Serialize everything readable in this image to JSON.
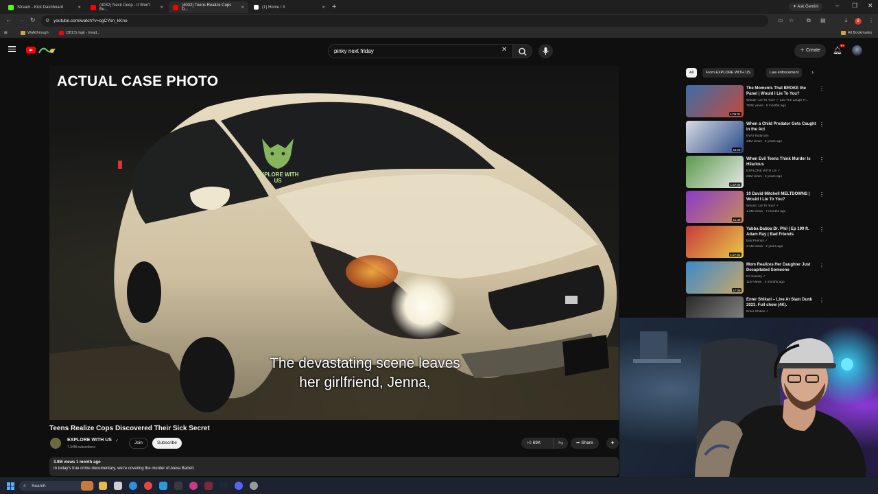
{
  "browser": {
    "tabs": [
      {
        "label": "Stream - Kick Dashboard",
        "color": "#53fc18",
        "active": false
      },
      {
        "label": "(4032) Neck Deep - It Won't Be...",
        "color": "#ff0000",
        "active": false
      },
      {
        "label": "(4032) Teens Realize Cops D...",
        "color": "#ff0000",
        "active": true
      },
      {
        "label": "(1) Home / X",
        "color": "#ffffff",
        "active": false
      }
    ],
    "new_tab": "+",
    "ask_gemini": "Ask Gemini",
    "url": "youtube.com/watch?v=cgCYon_kKno",
    "profile_badge": "8",
    "bookmarks": [
      {
        "label": "Walkthrough"
      },
      {
        "label": "(3813) mgk - tread..."
      }
    ],
    "all_bookmarks": "All Bookmarks"
  },
  "header": {
    "search_value": "pinky next friday",
    "create_label": "Create",
    "notification_count": "9+"
  },
  "video": {
    "overlay_label": "ACTUAL CASE PHOTO",
    "watermark_text": "EXPLORE WITH US",
    "caption_line1": "The devastating scene leaves",
    "caption_line2": "her girlfriend, Jenna,",
    "title": "Teens Realize Cops Discovered Their Sick Secret",
    "channel_name": "EXPLORE WITH US",
    "subscribers": "7.34M subscribers",
    "join_label": "Join",
    "subscribe_label": "Subscribe",
    "likes": "69K",
    "share_label": "Share",
    "views_age": "3.9M views  1 month ago",
    "description": "In today's true crime documentary, we're covering the murder of Alexa Bartell."
  },
  "chips": [
    {
      "label": "All",
      "active": true
    },
    {
      "label": "From EXPLORE WITH US",
      "active": false
    },
    {
      "label": "Law enforcement",
      "active": false
    }
  ],
  "recommendations": [
    {
      "title": "The Moments That BROKE the Panel | Would I Lie To You?",
      "channel": "Would I Lie To You? ✓ and The Laugh Tr...",
      "meta": "753K views · 5 months ago",
      "duration": "1:06:31",
      "thumb": [
        "#3a6ea8",
        "#c34a3a"
      ]
    },
    {
      "title": "When a Child Predator Gets Caught in the Act",
      "channel": "EWU Bodycam",
      "meta": "23M views · 2 years ago",
      "duration": "44:25",
      "thumb": [
        "#d7dbe3",
        "#2a4a8a"
      ]
    },
    {
      "title": "When Evil Teens Think Murder Is Hilarious",
      "channel": "EXPLORE WITH US ✓",
      "meta": "23M views · 2 years ago",
      "duration": "1:47:04",
      "thumb": [
        "#5a9a4a",
        "#e8e8e8"
      ]
    },
    {
      "title": "10 David Mitchell MELTDOWNS | Would I Lie To You?",
      "channel": "Would I Lie To You? ✓",
      "meta": "1.2M views · 7 months ago",
      "duration": "41:39",
      "thumb": [
        "#8a3ac8",
        "#c88a5a"
      ]
    },
    {
      "title": "Yabba Dabba Dr. Phil | Ep 199 ft. Adam Ray | Bad Friends",
      "channel": "Bad Friends ✓",
      "meta": "3.1M views · 2 years ago",
      "duration": "1:27:01",
      "thumb": [
        "#c83a3a",
        "#e8c84a"
      ]
    },
    {
      "title": "Mom Realizes Her Daughter Just Decapitated Someone",
      "channel": "Dr Insanity ✓",
      "meta": "11M views · 4 months ago",
      "duration": "47:09",
      "thumb": [
        "#3a8ac8",
        "#c8a86a"
      ]
    },
    {
      "title": "Enter Shikari – Live At Slam Dunk 2023. Full show (4K).",
      "channel": "Enter Shikari ✓",
      "meta": "",
      "duration": "",
      "thumb": [
        "#2a2a2a",
        "#8a8a8a"
      ]
    }
  ],
  "taskbar": {
    "search_label": "Search"
  }
}
